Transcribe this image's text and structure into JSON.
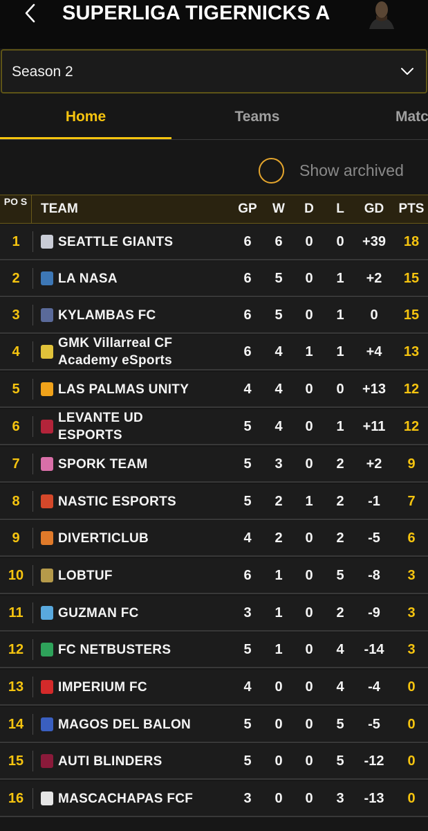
{
  "header": {
    "title": "SUPERLIGA TIGERNICKS A"
  },
  "season_select": {
    "value": "Season 2"
  },
  "tabs": [
    {
      "label": "Home"
    },
    {
      "label": "Teams"
    },
    {
      "label": "Matc"
    }
  ],
  "archived": {
    "label": "Show archived"
  },
  "table": {
    "headers": {
      "pos": "PO S",
      "team": "TEAM",
      "gp": "GP",
      "w": "W",
      "d": "D",
      "l": "L",
      "gd": "GD",
      "pts": "PTS"
    },
    "rows": [
      {
        "pos": "1",
        "team": "SEATTLE GIANTS",
        "gp": "6",
        "w": "6",
        "d": "0",
        "l": "0",
        "gd": "+39",
        "pts": "18",
        "logo_color": "#c9ccd6"
      },
      {
        "pos": "2",
        "team": "LA NASA",
        "gp": "6",
        "w": "5",
        "d": "0",
        "l": "1",
        "gd": "+2",
        "pts": "15",
        "logo_color": "#3d77b5"
      },
      {
        "pos": "3",
        "team": "KYLAMBAS FC",
        "gp": "6",
        "w": "5",
        "d": "0",
        "l": "1",
        "gd": "0",
        "pts": "15",
        "logo_color": "#5a6a9a"
      },
      {
        "pos": "4",
        "team": "GMK Villarreal CF Academy eSports",
        "gp": "6",
        "w": "4",
        "d": "1",
        "l": "1",
        "gd": "+4",
        "pts": "13",
        "logo_color": "#e0c23a"
      },
      {
        "pos": "5",
        "team": "LAS PALMAS UNITY",
        "gp": "4",
        "w": "4",
        "d": "0",
        "l": "0",
        "gd": "+13",
        "pts": "12",
        "logo_color": "#f0a21a"
      },
      {
        "pos": "6",
        "team": "LEVANTE UD ESPORTS",
        "gp": "5",
        "w": "4",
        "d": "0",
        "l": "1",
        "gd": "+11",
        "pts": "12",
        "logo_color": "#b3243a"
      },
      {
        "pos": "7",
        "team": "SPORK TEAM",
        "gp": "5",
        "w": "3",
        "d": "0",
        "l": "2",
        "gd": "+2",
        "pts": "9",
        "logo_color": "#d96fa8"
      },
      {
        "pos": "8",
        "team": "NASTIC ESPORTS",
        "gp": "5",
        "w": "2",
        "d": "1",
        "l": "2",
        "gd": "-1",
        "pts": "7",
        "logo_color": "#d4482a"
      },
      {
        "pos": "9",
        "team": "DIVERTICLUB",
        "gp": "4",
        "w": "2",
        "d": "0",
        "l": "2",
        "gd": "-5",
        "pts": "6",
        "logo_color": "#e07a2a"
      },
      {
        "pos": "10",
        "team": "LOBTUF",
        "gp": "6",
        "w": "1",
        "d": "0",
        "l": "5",
        "gd": "-8",
        "pts": "3",
        "logo_color": "#b59a4a"
      },
      {
        "pos": "11",
        "team": "GUZMAN FC",
        "gp": "3",
        "w": "1",
        "d": "0",
        "l": "2",
        "gd": "-9",
        "pts": "3",
        "logo_color": "#59a9de"
      },
      {
        "pos": "12",
        "team": "FC NETBUSTERS",
        "gp": "5",
        "w": "1",
        "d": "0",
        "l": "4",
        "gd": "-14",
        "pts": "3",
        "logo_color": "#2ea25a"
      },
      {
        "pos": "13",
        "team": "IMPERIUM FC",
        "gp": "4",
        "w": "0",
        "d": "0",
        "l": "4",
        "gd": "-4",
        "pts": "0",
        "logo_color": "#d42a2a"
      },
      {
        "pos": "14",
        "team": "MAGOS DEL BALON",
        "gp": "5",
        "w": "0",
        "d": "0",
        "l": "5",
        "gd": "-5",
        "pts": "0",
        "logo_color": "#3a5fc0"
      },
      {
        "pos": "15",
        "team": "AUTI BLINDERS",
        "gp": "5",
        "w": "0",
        "d": "0",
        "l": "5",
        "gd": "-12",
        "pts": "0",
        "logo_color": "#8a1a3a"
      },
      {
        "pos": "16",
        "team": "MASCACHAPAS FCF",
        "gp": "3",
        "w": "0",
        "d": "0",
        "l": "3",
        "gd": "-13",
        "pts": "0",
        "logo_color": "#e6e6e6"
      }
    ]
  }
}
